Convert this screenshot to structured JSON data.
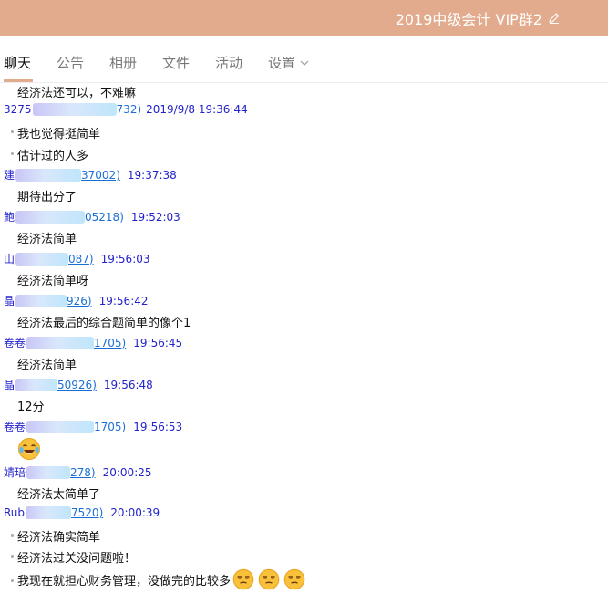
{
  "window": {
    "title": "2019中级会计 VIP群2"
  },
  "tabs": [
    {
      "label": "聊天",
      "active": true
    },
    {
      "label": "公告"
    },
    {
      "label": "相册"
    },
    {
      "label": "文件"
    },
    {
      "label": "活动"
    },
    {
      "label": "设置"
    }
  ],
  "messages": {
    "m0": "经济法还可以，不难嘛",
    "m1": "我也觉得挺简单",
    "m2": "估计过的人多",
    "m3": "期待出分了",
    "m4": "经济法简单",
    "m5": "经济法简单呀",
    "m6": "经济法最后的综合题简单的像个1",
    "m7": "经济法简单",
    "m8": "12分",
    "m9": "经济法太简单了",
    "m10": "经济法确实简单",
    "m11": "经济法过关没问题啦！",
    "m12": "我现在就担心财务管理，没做完的比较多"
  },
  "senders": {
    "s0": {
      "name": "3275",
      "id": "732)",
      "time": "2019/9/8 19:36:44"
    },
    "s1": {
      "name": "建",
      "id": "37002)",
      "time": "19:37:38"
    },
    "s2": {
      "name": "鲍",
      "id": "05218)",
      "time": "19:52:03"
    },
    "s3": {
      "name": "山",
      "id": "087)",
      "time": "19:56:03"
    },
    "s4": {
      "name": "晶",
      "id": "926)",
      "time": "19:56:42"
    },
    "s5": {
      "name": "卷卷",
      "id": "1705)",
      "time": "19:56:45"
    },
    "s6": {
      "name": "晶",
      "id": "50926)",
      "time": "19:56:48"
    },
    "s7": {
      "name": "卷卷",
      "id": "1705)",
      "time": "19:56:53"
    },
    "s8": {
      "name": "婧琣",
      "id": "278)",
      "time": "20:00:25"
    },
    "s9": {
      "name": "Rub",
      "id": "7520)",
      "time": "20:00:39"
    }
  },
  "colors": {
    "titlebar": "#e3ab8d",
    "sender_name": "#2222cc",
    "sender_id": "#1a6fd6"
  },
  "icons": {
    "edit": "pencil-icon",
    "dropdown": "chevron-down-icon",
    "emoji_cry_laugh": "tears-of-joy-emoji",
    "emoji_smirk": "unamused-emoji"
  }
}
